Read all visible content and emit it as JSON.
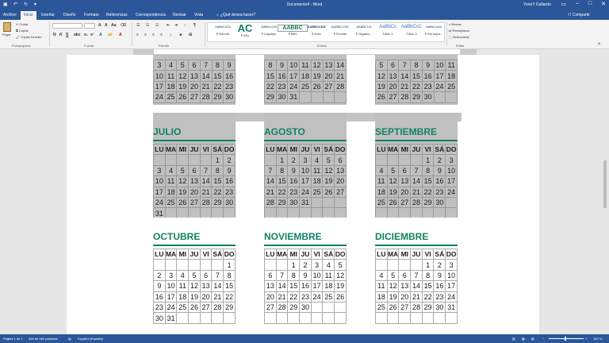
{
  "window": {
    "title": "Documento4  -  Word",
    "user": "YoneY Gallardo"
  },
  "tabs": [
    {
      "label": "Archivo",
      "active": false
    },
    {
      "label": "Inicio",
      "active": true
    },
    {
      "label": "Insertar",
      "active": false
    },
    {
      "label": "Diseño",
      "active": false
    },
    {
      "label": "Formato",
      "active": false
    },
    {
      "label": "Referencias",
      "active": false
    },
    {
      "label": "Correspondencia",
      "active": false
    },
    {
      "label": "Revisar",
      "active": false
    },
    {
      "label": "Vista",
      "active": false
    }
  ],
  "tellme": "¿Qué desea hacer?",
  "share": "Compartir",
  "ribbon": {
    "paste": "Pegar",
    "cut": "Cortar",
    "copy": "Copiar",
    "format_painter": "Copiar formato",
    "groups": {
      "clipboard": "Portapapeles",
      "font": "Fuente",
      "paragraph": "Párrafo",
      "styles": "Estilos",
      "editing": "Editar"
    },
    "styles": [
      {
        "preview": "AaBbCcDd",
        "name": "¶ Normal"
      },
      {
        "preview": "AaBbCcDd",
        "name": "¶ Año"
      },
      {
        "preview": "AaBbCcDd",
        "name": "¶ Logotipo"
      },
      {
        "preview": "AABBC",
        "name": "¶ Mes"
      },
      {
        "preview": "AABBCCDD",
        "name": "¶ Días"
      },
      {
        "preview": "AABBCCDD",
        "name": "¶ Fechas"
      },
      {
        "preview": "AABBCCD",
        "name": "¶ Organiz..."
      },
      {
        "preview": "AaBbCc",
        "name": "Título 1"
      },
      {
        "preview": "AaBbCcC",
        "name": "Título 2"
      },
      {
        "preview": "AaBbCcDd",
        "name": "¶ Sin espa..."
      }
    ],
    "editing": {
      "find": "Buscar",
      "replace": "Reemplazar",
      "select": "Seleccionar"
    }
  },
  "status": {
    "page": "Página 1 de 1",
    "words": "346 de 462 palabras",
    "language": "Español (España)",
    "zoom": "190 %"
  },
  "calendar": {
    "day_headers": [
      "LU",
      "MA",
      "MI",
      "JU",
      "VI",
      "SÁ",
      "DO"
    ],
    "top_partial": [
      {
        "rows": [
          [
            "3",
            "4",
            "5",
            "6",
            "7",
            "8",
            "9"
          ],
          [
            "10",
            "11",
            "12",
            "13",
            "14",
            "15",
            "16"
          ],
          [
            "17",
            "18",
            "19",
            "20",
            "21",
            "22",
            "23"
          ],
          [
            "24",
            "25",
            "26",
            "27",
            "28",
            "29",
            "30"
          ]
        ]
      },
      {
        "rows": [
          [
            "8",
            "9",
            "10",
            "11",
            "12",
            "13",
            "14"
          ],
          [
            "15",
            "16",
            "17",
            "18",
            "19",
            "20",
            "21"
          ],
          [
            "22",
            "23",
            "24",
            "25",
            "26",
            "27",
            "28"
          ],
          [
            "29",
            "30",
            "31",
            "",
            "",
            "",
            ""
          ]
        ]
      },
      {
        "rows": [
          [
            "5",
            "6",
            "7",
            "8",
            "9",
            "10",
            "11"
          ],
          [
            "12",
            "13",
            "14",
            "15",
            "16",
            "17",
            "18"
          ],
          [
            "19",
            "20",
            "21",
            "22",
            "23",
            "24",
            "25"
          ],
          [
            "26",
            "27",
            "28",
            "29",
            "30",
            "",
            ""
          ]
        ]
      }
    ],
    "months": [
      {
        "name": "JULIO",
        "rows": [
          [
            "",
            "",
            "",
            "",
            "",
            "1",
            "2"
          ],
          [
            "3",
            "4",
            "5",
            "6",
            "7",
            "8",
            "9"
          ],
          [
            "10",
            "11",
            "12",
            "13",
            "14",
            "15",
            "16"
          ],
          [
            "17",
            "18",
            "19",
            "20",
            "21",
            "22",
            "23"
          ],
          [
            "24",
            "25",
            "26",
            "27",
            "28",
            "29",
            "30"
          ],
          [
            "31",
            "",
            "",
            "",
            "",
            "",
            ""
          ]
        ]
      },
      {
        "name": "AGOSTO",
        "rows": [
          [
            "",
            "1",
            "2",
            "3",
            "4",
            "5",
            "6"
          ],
          [
            "7",
            "8",
            "9",
            "10",
            "11",
            "12",
            "13"
          ],
          [
            "14",
            "15",
            "16",
            "17",
            "18",
            "19",
            "20"
          ],
          [
            "21",
            "22",
            "23",
            "24",
            "25",
            "26",
            "27"
          ],
          [
            "28",
            "29",
            "30",
            "31",
            "",
            "",
            ""
          ],
          [
            "",
            "",
            "",
            "",
            "",
            "",
            ""
          ]
        ]
      },
      {
        "name": "SEPTIEMBRE",
        "rows": [
          [
            "",
            "",
            "",
            "",
            "1",
            "2",
            "3"
          ],
          [
            "4",
            "5",
            "6",
            "7",
            "8",
            "9",
            "10"
          ],
          [
            "11",
            "12",
            "13",
            "14",
            "15",
            "16",
            "17"
          ],
          [
            "18",
            "19",
            "20",
            "21",
            "22",
            "23",
            "24"
          ],
          [
            "25",
            "26",
            "27",
            "28",
            "29",
            "30",
            ""
          ],
          [
            "",
            "",
            "",
            "",
            "",
            "",
            ""
          ]
        ]
      },
      {
        "name": "OCTUBRE",
        "rows": [
          [
            "",
            "",
            "",
            "",
            "",
            "",
            "1"
          ],
          [
            "2",
            "3",
            "4",
            "5",
            "6",
            "7",
            "8"
          ],
          [
            "9",
            "10",
            "11",
            "12",
            "13",
            "14",
            "15"
          ],
          [
            "16",
            "17",
            "18",
            "19",
            "20",
            "21",
            "22"
          ],
          [
            "23",
            "24",
            "25",
            "26",
            "27",
            "28",
            "29"
          ],
          [
            "30",
            "31",
            "",
            "",
            "",
            "",
            ""
          ]
        ]
      },
      {
        "name": "NOVIEMBRE",
        "rows": [
          [
            "",
            "",
            "1",
            "2",
            "3",
            "4",
            "5"
          ],
          [
            "6",
            "7",
            "8",
            "9",
            "10",
            "11",
            "12"
          ],
          [
            "13",
            "14",
            "15",
            "16",
            "17",
            "18",
            "19"
          ],
          [
            "20",
            "21",
            "22",
            "23",
            "24",
            "25",
            "26"
          ],
          [
            "27",
            "28",
            "29",
            "30",
            "",
            "",
            ""
          ],
          [
            "",
            "",
            "",
            "",
            "",
            "",
            ""
          ]
        ]
      },
      {
        "name": "DICIEMBRE",
        "rows": [
          [
            "",
            "",
            "",
            "",
            "1",
            "2",
            "3"
          ],
          [
            "4",
            "5",
            "6",
            "7",
            "8",
            "9",
            "10"
          ],
          [
            "11",
            "12",
            "13",
            "14",
            "15",
            "16",
            "17"
          ],
          [
            "18",
            "19",
            "20",
            "21",
            "22",
            "23",
            "24"
          ],
          [
            "25",
            "26",
            "27",
            "28",
            "29",
            "30",
            "31"
          ],
          [
            "",
            "",
            "",
            "",
            "",
            "",
            ""
          ]
        ]
      }
    ]
  },
  "colors": {
    "accent": "#2b579a",
    "month_title": "#128263",
    "selection_gray": "#c0c0c0"
  }
}
